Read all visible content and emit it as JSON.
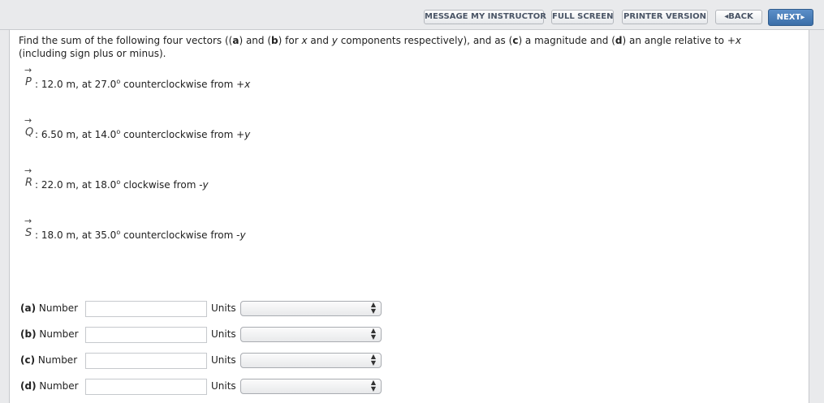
{
  "toolbar": {
    "message_instructor": "MESSAGE MY INSTRUCTOR",
    "full_screen": "FULL SCREEN",
    "printer_version": "PRINTER VERSION",
    "back": "BACK",
    "next": "NEXT"
  },
  "question": {
    "p1": "Find the sum of the following four vectors ((",
    "a": "a",
    "p2": ") and (",
    "b": "b",
    "p3": ") for ",
    "x1": "x",
    "p4": " and ",
    "y1": "y",
    "p5": " components respectively), and as (",
    "c": "c",
    "p6": ") a magnitude and (",
    "d": "d",
    "p7": ") an angle relative to +",
    "x2": "x",
    "p8": "(including sign plus or minus)."
  },
  "vectors": [
    {
      "letter": "P",
      "text": ": 12.0 m, at 27.0",
      "deg": "o",
      "dir": " counterclockwise from +",
      "axis": "x"
    },
    {
      "letter": "Q",
      "text": ": 6.50 m, at 14.0",
      "deg": "o",
      "dir": " counterclockwise from +",
      "axis": "y"
    },
    {
      "letter": "R",
      "text": ": 22.0 m, at 18.0",
      "deg": "o",
      "dir": " clockwise from -",
      "axis": "y"
    },
    {
      "letter": "S",
      "text": ": 18.0 m, at 35.0",
      "deg": "o",
      "dir": " counterclockwise from -",
      "axis": "y"
    }
  ],
  "answers": [
    {
      "part": "(a)",
      "label": "Number",
      "value": "",
      "units_label": "Units",
      "units_value": ""
    },
    {
      "part": "(b)",
      "label": "Number",
      "value": "",
      "units_label": "Units",
      "units_value": ""
    },
    {
      "part": "(c)",
      "label": "Number",
      "value": "",
      "units_label": "Units",
      "units_value": ""
    },
    {
      "part": "(d)",
      "label": "Number",
      "value": "",
      "units_label": "Units",
      "units_value": ""
    }
  ],
  "icons": {
    "back": "chevron-left-icon",
    "next": "chevron-right-icon",
    "vector_arrow": "arrow-right-icon",
    "select": "up-down-caret-icon"
  }
}
